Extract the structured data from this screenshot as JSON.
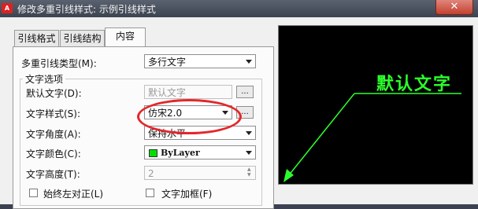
{
  "window": {
    "title": "修改多重引线样式: 示例引线样式",
    "app_icon_text": "A",
    "close_label": "✕"
  },
  "tabs": [
    {
      "label": "引线格式",
      "active": false
    },
    {
      "label": "引线结构",
      "active": false
    },
    {
      "label": "内容",
      "active": true
    }
  ],
  "content": {
    "leader_type_label": "多重引线类型(M):",
    "leader_type_value": "多行文字",
    "text_options_title": "文字选项",
    "default_text_label": "默认文字(D):",
    "default_text_value": "默认文字",
    "text_style_label": "文字样式(S):",
    "text_style_value": "仿宋2.0",
    "text_angle_label": "文字角度(A):",
    "text_angle_value": "保持水平",
    "text_color_label": "文字颜色(C):",
    "text_color_value": "ByLayer",
    "text_color_swatch": "#00e000",
    "text_height_label": "文字高度(T):",
    "text_height_value": "2",
    "always_left_label": "始终左对正(L)",
    "text_frame_label": "文字加框(F)",
    "ellipsis_label": "..."
  },
  "preview": {
    "text": "默认文字",
    "color": "#2cff2c"
  },
  "annotation": {
    "highlight_color": "#e4272b"
  }
}
